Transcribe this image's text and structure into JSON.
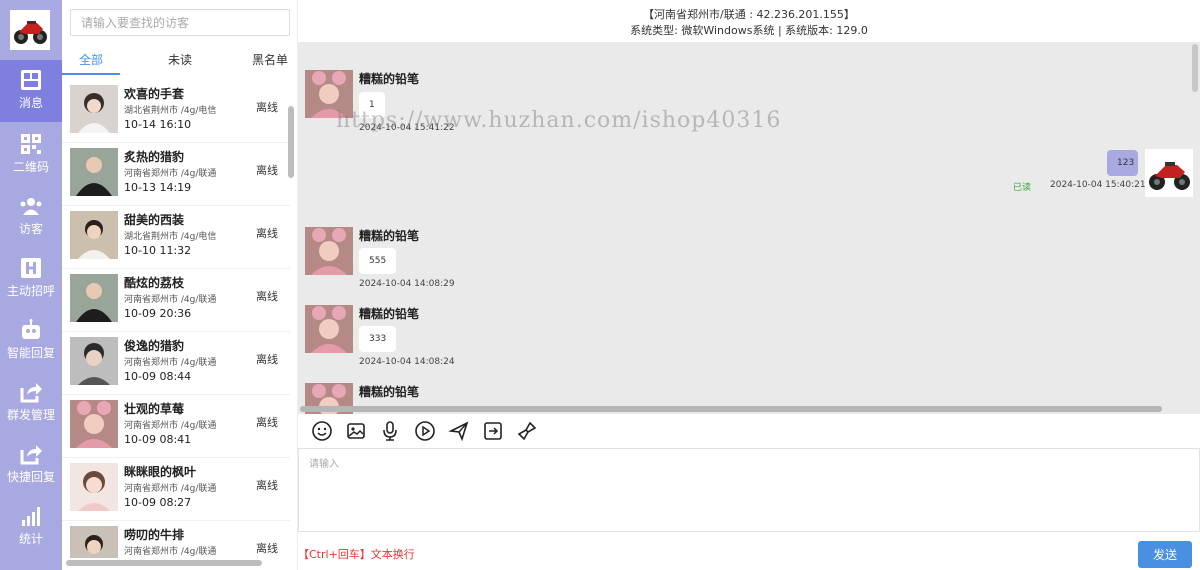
{
  "nav": {
    "items": [
      {
        "label": "消息",
        "icon": "message-icon"
      },
      {
        "label": "二维码",
        "icon": "qrcode-icon"
      },
      {
        "label": "访客",
        "icon": "visitors-icon"
      },
      {
        "label": "主动招呼",
        "icon": "greet-icon"
      },
      {
        "label": "智能回复",
        "icon": "robot-icon"
      },
      {
        "label": "群发管理",
        "icon": "share-icon"
      },
      {
        "label": "快捷回复",
        "icon": "share-icon"
      },
      {
        "label": "统计",
        "icon": "bar-chart-icon"
      }
    ],
    "accent": "#7f7fe0",
    "background": "#a9a9e2"
  },
  "search": {
    "placeholder": "请输入要查找的访客"
  },
  "tabs": [
    "全部",
    "未读",
    "黑名单"
  ],
  "visitors": [
    {
      "name": "欢喜的手套",
      "location": "湖北省荆州市 /4g/电信",
      "time": "10-14 16:10",
      "status": "离线"
    },
    {
      "name": "炙热的猎豹",
      "location": "河南省郑州市 /4g/联通",
      "time": "10-13 14:19",
      "status": "离线"
    },
    {
      "name": "甜美的西装",
      "location": "湖北省荆州市 /4g/电信",
      "time": "10-10 11:32",
      "status": "离线"
    },
    {
      "name": "酷炫的荔枝",
      "location": "河南省郑州市 /4g/联通",
      "time": "10-09 20:36",
      "status": "离线"
    },
    {
      "name": "俊逸的猎豹",
      "location": "河南省郑州市 /4g/联通",
      "time": "10-09 08:44",
      "status": "离线"
    },
    {
      "name": "壮观的草莓",
      "location": "河南省郑州市 /4g/联通",
      "time": "10-09 08:41",
      "status": "离线"
    },
    {
      "name": "眯眯眼的枫叶",
      "location": "河南省郑州市 /4g/联通",
      "time": "10-09 08:27",
      "status": "离线"
    },
    {
      "name": "唠叨的牛排",
      "location": "河南省郑州市 /4g/联通",
      "time": "",
      "status": "离线"
    }
  ],
  "chat": {
    "header_location": "【河南省郑州市/联通 : 42.236.201.155】",
    "header_system": "系统类型:  微软Windows系统 | 系统版本: 129.0",
    "watermark": "https://www.huzhan.com/ishop40316",
    "messages": [
      {
        "sender": "糟糕的铅笔",
        "text": "1",
        "time": "2024-10-04 15:41:22",
        "direction": "in"
      },
      {
        "sender": "",
        "text": "123",
        "time": "2024-10-04 15:40:21",
        "direction": "out",
        "read": "已读"
      },
      {
        "sender": "糟糕的铅笔",
        "text": "555",
        "time": "2024-10-04 14:08:29",
        "direction": "in"
      },
      {
        "sender": "糟糕的铅笔",
        "text": "333",
        "time": "2024-10-04 14:08:24",
        "direction": "in"
      },
      {
        "sender": "糟糕的铅笔",
        "text": "",
        "time": "",
        "direction": "in"
      }
    ],
    "toolbar": [
      "emoji-icon",
      "image-icon",
      "microphone-icon",
      "video-play-icon",
      "send-plane-icon",
      "file-transfer-icon",
      "clear-broom-icon"
    ],
    "input_placeholder": "请输入",
    "hint": "【Ctrl+回车】文本换行",
    "send_label": "发送",
    "send_color": "#4a90e2"
  }
}
